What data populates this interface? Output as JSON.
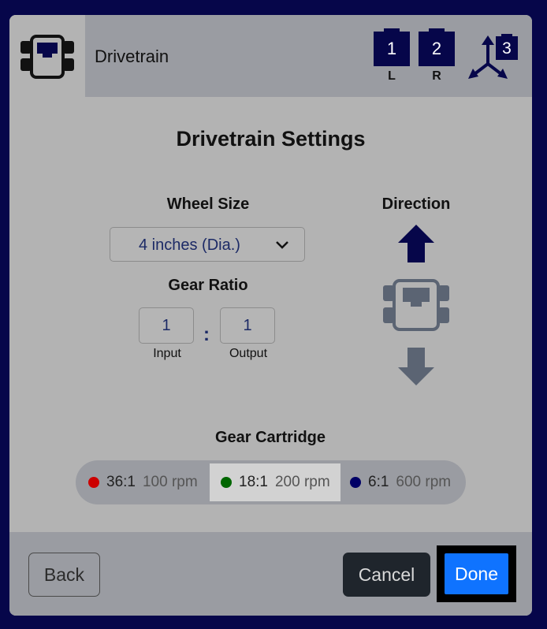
{
  "header": {
    "title": "Drivetrain",
    "ports": [
      {
        "number": "1",
        "label": "L"
      },
      {
        "number": "2",
        "label": "R"
      },
      {
        "number": "3",
        "label": ""
      }
    ]
  },
  "settings": {
    "title": "Drivetrain Settings",
    "wheel_size_label": "Wheel Size",
    "wheel_size_value": "4 inches (Dia.)",
    "gear_ratio_label": "Gear Ratio",
    "input_value": "1",
    "output_value": "1",
    "input_label": "Input",
    "output_label": "Output",
    "ratio_separator": ":",
    "direction_label": "Direction"
  },
  "cartridge": {
    "label": "Gear Cartridge",
    "options": [
      {
        "ratio": "36:1",
        "rpm": "100 rpm",
        "color": "#cc0000",
        "selected": false
      },
      {
        "ratio": "18:1",
        "rpm": "200 rpm",
        "color": "#006600",
        "selected": true
      },
      {
        "ratio": "6:1",
        "rpm": "600 rpm",
        "color": "#000066",
        "selected": false
      }
    ]
  },
  "footer": {
    "back_label": "Back",
    "cancel_label": "Cancel",
    "done_label": "Done"
  },
  "colors": {
    "navy": "#06064a",
    "accent_blue": "#0f73ff"
  }
}
